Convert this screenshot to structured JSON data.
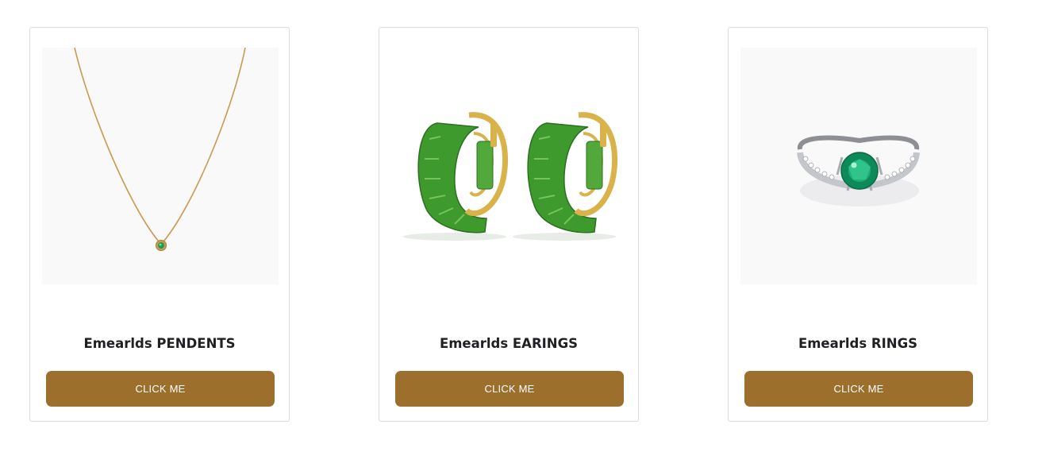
{
  "accent_color": "#9d6f2c",
  "products": [
    {
      "title": "Emearlds PENDENTS",
      "button_label": "CLICK ME",
      "image_icon": "emerald-necklace-image"
    },
    {
      "title": "Emearlds EARINGS",
      "button_label": "CLICK ME",
      "image_icon": "emerald-earrings-image"
    },
    {
      "title": "Emearlds RINGS",
      "button_label": "CLICK ME",
      "image_icon": "emerald-ring-image"
    }
  ]
}
